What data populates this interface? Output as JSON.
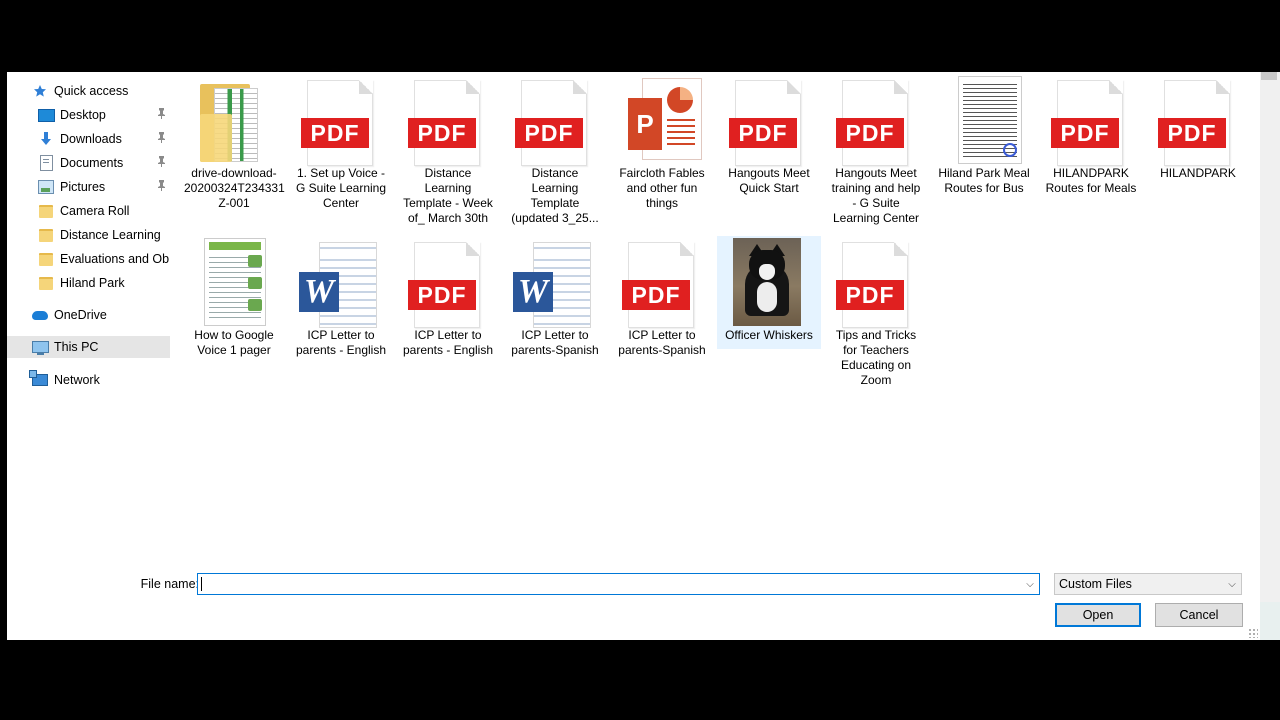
{
  "nav": {
    "items": [
      {
        "label": "Quick access",
        "icon": "star-icon",
        "pinned": false,
        "selected": false
      },
      {
        "label": "Desktop",
        "icon": "desktop-icon",
        "pinned": true,
        "selected": false
      },
      {
        "label": "Downloads",
        "icon": "download-arrow-icon",
        "pinned": true,
        "selected": false
      },
      {
        "label": "Documents",
        "icon": "document-icon",
        "pinned": true,
        "selected": false
      },
      {
        "label": "Pictures",
        "icon": "pictures-icon",
        "pinned": true,
        "selected": false
      },
      {
        "label": "Camera Roll",
        "icon": "folder-icon",
        "pinned": false,
        "selected": false
      },
      {
        "label": "Distance Learning",
        "icon": "folder-icon",
        "pinned": false,
        "selected": false
      },
      {
        "label": "Evaluations and Ob",
        "icon": "folder-icon",
        "pinned": false,
        "selected": false
      },
      {
        "label": "Hiland Park",
        "icon": "folder-icon",
        "pinned": false,
        "selected": false
      },
      {
        "label": "OneDrive",
        "icon": "cloud-icon",
        "pinned": false,
        "selected": false
      },
      {
        "label": "This PC",
        "icon": "computer-icon",
        "pinned": false,
        "selected": true
      },
      {
        "label": "Network",
        "icon": "network-icon",
        "pinned": false,
        "selected": false
      }
    ]
  },
  "files": [
    {
      "label": "drive-download-20200324T234331Z-001",
      "display": "drive-download-\n20200324T234331\nZ-001",
      "kind": "zip-folder"
    },
    {
      "label": "1. Set up Voice - G Suite Learning Center",
      "display": "1. Set up Voice -\nG Suite Learning\nCenter",
      "kind": "pdf"
    },
    {
      "label": "Distance Learning Template - Week of_ March 30th",
      "display": "Distance\nLearning\nTemplate - Week\nof_ March 30th",
      "kind": "pdf"
    },
    {
      "label": "Distance Learning Template (updated 3_25...",
      "display": "Distance\nLearning\nTemplate\n(updated 3_25...",
      "kind": "pdf"
    },
    {
      "label": "Faircloth Fables and other fun things",
      "display": "Faircloth Fables\nand other fun\nthings",
      "kind": "ppt"
    },
    {
      "label": "Hangouts Meet Quick Start",
      "display": "Hangouts Meet\nQuick Start",
      "kind": "pdf"
    },
    {
      "label": "Hangouts Meet training and help - G Suite Learning Center",
      "display": "Hangouts Meet\ntraining and help\n- G Suite\nLearning Center",
      "kind": "pdf"
    },
    {
      "label": "Hiland Park Meal Routes for Bus",
      "display": "Hiland Park Meal\nRoutes for Bus",
      "kind": "doc-memo"
    },
    {
      "label": "HILANDPARK Routes for Meals",
      "display": "HILANDPARK\nRoutes for Meals",
      "kind": "pdf"
    },
    {
      "label": "HILANDPARK",
      "display": "HILANDPARK",
      "kind": "pdf"
    },
    {
      "label": "How to Google Voice 1 pager",
      "display": "How to Google\nVoice 1 pager",
      "kind": "doc-guide"
    },
    {
      "label": "ICP Letter to parents - English",
      "display": "ICP Letter to\nparents - English",
      "kind": "word"
    },
    {
      "label": "ICP Letter to parents - English",
      "display": "ICP Letter to\nparents - English",
      "kind": "pdf"
    },
    {
      "label": "ICP Letter to parents-Spanish",
      "display": "ICP Letter to\nparents-Spanish",
      "kind": "word"
    },
    {
      "label": "ICP Letter to parents-Spanish",
      "display": "ICP Letter to\nparents-Spanish",
      "kind": "pdf"
    },
    {
      "label": "Officer Whiskers",
      "display": "Officer Whiskers",
      "kind": "photo",
      "hovered": true
    },
    {
      "label": "Tips and Tricks for Teachers Educating on Zoom",
      "display": "Tips and Tricks\nfor Teachers\nEducating on\nZoom",
      "kind": "pdf"
    }
  ],
  "bottom": {
    "filename_label": "File name:",
    "filename_value": "",
    "filter_value": "Custom Files",
    "open_label": "Open",
    "cancel_label": "Cancel"
  },
  "icons": {
    "pdf_text": "PDF",
    "word_letter": "W",
    "ppt_letter": "P",
    "pin": "📌",
    "chevron": "⌄"
  },
  "colors": {
    "selection": "#e5e5e5",
    "hover": "#e5f3ff",
    "accent": "#0078d7",
    "pdf_red": "#e02020",
    "word_blue": "#2b579a"
  }
}
